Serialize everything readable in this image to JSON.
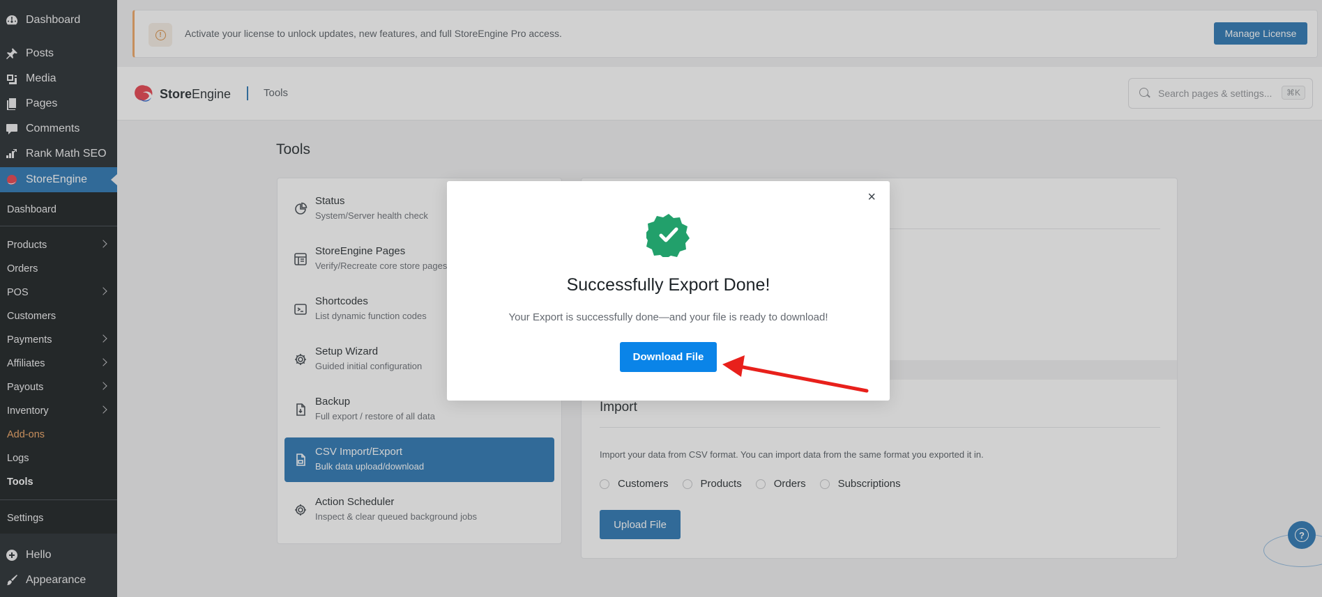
{
  "wp_menu": {
    "top_items": [
      {
        "label": "Dashboard",
        "icon": "dashboard-icon"
      },
      {
        "label": "Posts",
        "icon": "pin-icon"
      },
      {
        "label": "Media",
        "icon": "media-icon"
      },
      {
        "label": "Pages",
        "icon": "pages-icon"
      },
      {
        "label": "Comments",
        "icon": "comments-icon"
      },
      {
        "label": "Rank Math SEO",
        "icon": "rank-math-icon"
      },
      {
        "label": "StoreEngine",
        "icon": "storeengine-icon"
      }
    ],
    "submenu": [
      {
        "label": "Dashboard"
      },
      {
        "label": "Products"
      },
      {
        "label": "Orders"
      },
      {
        "label": "POS"
      },
      {
        "label": "Customers"
      },
      {
        "label": "Payments"
      },
      {
        "label": "Affiliates"
      },
      {
        "label": "Payouts"
      },
      {
        "label": "Inventory"
      },
      {
        "label": "Add-ons"
      },
      {
        "label": "Logs"
      },
      {
        "label": "Tools"
      },
      {
        "label": "Settings"
      }
    ],
    "bottom_items": [
      {
        "label": "Hello",
        "icon": "plus-circle-icon"
      },
      {
        "label": "Appearance",
        "icon": "brush-icon"
      }
    ]
  },
  "license_notice": {
    "message": "Activate your license to unlock updates, new features, and full StoreEngine Pro access.",
    "button_label": "Manage License"
  },
  "header": {
    "brand_bold": "Store",
    "brand_rest": "Engine",
    "breadcrumb": "Tools",
    "search_placeholder": "Search pages & settings...",
    "search_shortcut": "⌘K"
  },
  "page_title": "Tools",
  "tools_nav": [
    {
      "title": "Status",
      "desc": "System/Server health check",
      "icon": "pie-chart-icon"
    },
    {
      "title": "StoreEngine Pages",
      "desc": "Verify/Recreate core store pages",
      "icon": "layout-icon"
    },
    {
      "title": "Shortcodes",
      "desc": "List dynamic function codes",
      "icon": "terminal-icon"
    },
    {
      "title": "Setup Wizard",
      "desc": "Guided initial configuration",
      "icon": "settings-icon"
    },
    {
      "title": "Backup",
      "desc": "Full export / restore of all data",
      "icon": "file-icon"
    },
    {
      "title": "CSV Import/Export",
      "desc": "Bulk data upload/download",
      "icon": "csv-file-icon",
      "active": true
    },
    {
      "title": "Action Scheduler",
      "desc": "Inspect & clear queued background jobs",
      "icon": "scheduler-icon"
    }
  ],
  "import_section": {
    "title": "Import",
    "description": "Import your data from CSV format. You can import data from the same format you exported it in.",
    "options": [
      "Customers",
      "Products",
      "Orders",
      "Subscriptions"
    ],
    "upload_label": "Upload File"
  },
  "modal": {
    "title": "Successfully Export Done!",
    "description": "Your Export is successfully done—and your file is ready to download!",
    "button_label": "Download File",
    "close_glyph": "×"
  },
  "colors": {
    "wp_sidebar": "#1d2327",
    "accent": "#2271b1",
    "success": "#22a06b",
    "annotation_arrow": "#e8201b"
  }
}
